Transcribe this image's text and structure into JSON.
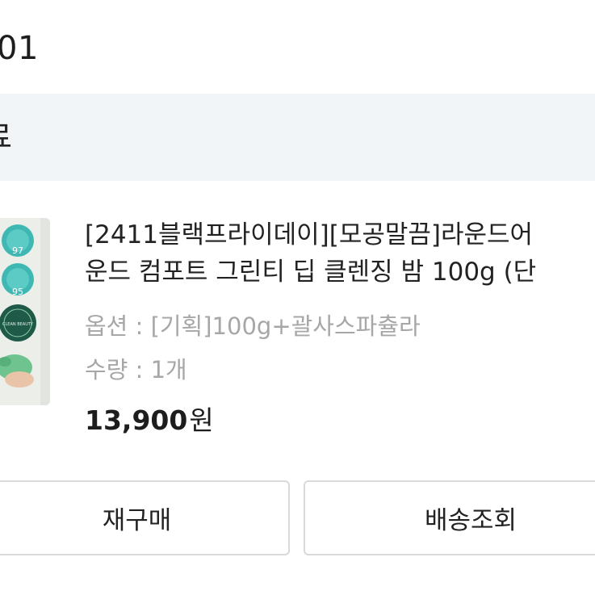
{
  "order": {
    "id_partial": "01"
  },
  "status": {
    "label_partial": "료"
  },
  "product": {
    "image_icon": "product-thumbnail",
    "title_line1": "[2411블랙프라이데이][모공말끔]라운드어",
    "title_line2": "운드 컴포트 그린티 딥 클렌징 밤 100g (단",
    "option_text": "옵션 : [기획]100g+괄사스파츌라",
    "quantity_text": "수량 : 1개",
    "price_amount": "13,900",
    "price_unit": "원"
  },
  "thumbnail_badges": [
    "97",
    "95",
    "CLEAN BEAUTY"
  ],
  "actions": {
    "rebuy_label": "재구매",
    "track_label": "배송조회"
  },
  "colors": {
    "status_band_bg": "#f2f5f8",
    "muted_text": "#a7a7a7",
    "button_border": "#d9d9d9",
    "badge_teal": "#3fb8b4"
  }
}
